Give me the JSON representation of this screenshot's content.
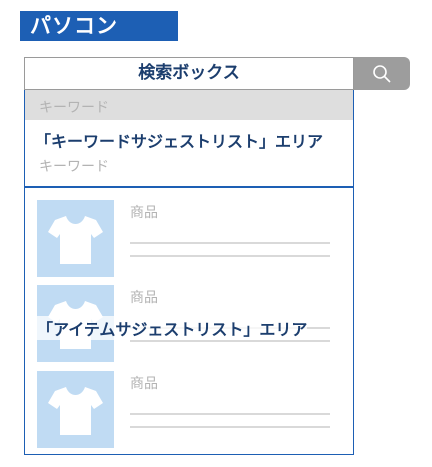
{
  "section_badge": "パソコン",
  "search": {
    "box_label": "検索ボックス",
    "button_icon": "search-icon"
  },
  "keyword_suggest": {
    "keywords": [
      "キーワード",
      "キーワード"
    ],
    "area_label": "「キーワードサジェストリスト」エリア"
  },
  "item_suggest": {
    "items": [
      {
        "name": "商品",
        "thumb_icon": "tshirt-icon"
      },
      {
        "name": "商品",
        "thumb_icon": "tshirt-icon"
      },
      {
        "name": "商品",
        "thumb_icon": "tshirt-icon"
      }
    ],
    "area_label": "「アイテムサジェストリスト」エリア"
  },
  "colors": {
    "brand_blue": "#1d5fb4",
    "label_navy": "#1c3e6e",
    "thumb_bg": "#c0dbf3",
    "button_gray": "#9d9d9d"
  }
}
